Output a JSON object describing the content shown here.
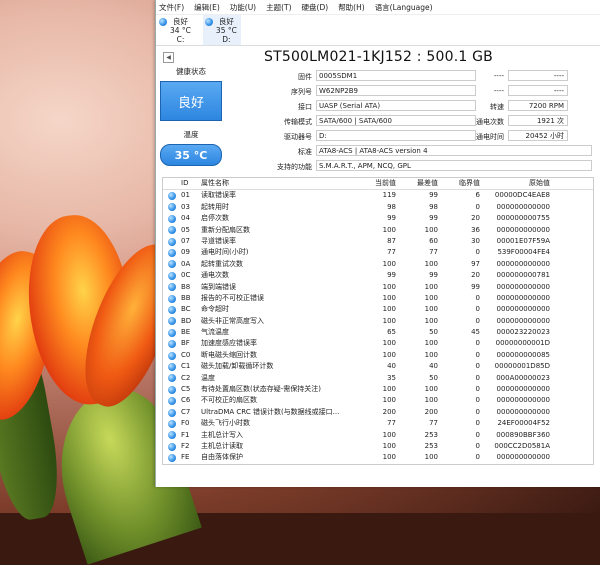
{
  "menu": [
    "文件(F)",
    "编辑(E)",
    "功能(U)",
    "主题(T)",
    "硬盘(D)",
    "帮助(H)",
    "语言(Language)"
  ],
  "disks": [
    {
      "status": "良好",
      "temp": "34 °C",
      "letter": "C:"
    },
    {
      "status": "良好",
      "temp": "35 °C",
      "letter": "D:"
    }
  ],
  "model": "ST500LM021-1KJ152 : 500.1 GB",
  "left": {
    "health_label": "健康状态",
    "health_value": "良好",
    "temp_label": "温度",
    "temp_value": "35 °C"
  },
  "info": {
    "firmware_label": "固件",
    "firmware": "0005SDM1",
    "serial_label": "序列号",
    "serial": "W62NP2B9",
    "interface_label": "接口",
    "interface": "UASP (Serial ATA)",
    "transfer_label": "传输模式",
    "transfer": "SATA/600 | SATA/600",
    "drive_label": "驱动器号",
    "drive": "D:",
    "standard_label": "标准",
    "standard": "ATA8-ACS | ATA8-ACS version 4",
    "features_label": "支持的功能",
    "features": "S.M.A.R.T., APM, NCQ, GPL",
    "r1_label": "----",
    "r1_value": "----",
    "r2_label": "----",
    "r2_value": "----",
    "rpm_label": "转速",
    "rpm": "7200 RPM",
    "power_count_label": "通电次数",
    "power_count": "1921 次",
    "power_hours_label": "通电时间",
    "power_hours": "20452 小时"
  },
  "table": {
    "headers": [
      "ID",
      "属性名称",
      "当前值",
      "最差值",
      "临界值",
      "原始值"
    ],
    "rows": [
      [
        "01",
        "读取错误率",
        "119",
        "99",
        "6",
        "00000DC4EAE8"
      ],
      [
        "03",
        "起转用时",
        "98",
        "98",
        "0",
        "000000000000"
      ],
      [
        "04",
        "启停次数",
        "99",
        "99",
        "20",
        "000000000755"
      ],
      [
        "05",
        "重新分配扇区数",
        "100",
        "100",
        "36",
        "000000000000"
      ],
      [
        "07",
        "寻道错误率",
        "87",
        "60",
        "30",
        "00001E07F59A"
      ],
      [
        "09",
        "通电时间(小时)",
        "77",
        "77",
        "0",
        "539F00004FE4"
      ],
      [
        "0A",
        "起转重试次数",
        "100",
        "100",
        "97",
        "000000000000"
      ],
      [
        "0C",
        "通电次数",
        "99",
        "99",
        "20",
        "000000000781"
      ],
      [
        "B8",
        "端到端错误",
        "100",
        "100",
        "99",
        "000000000000"
      ],
      [
        "BB",
        "报告的不可校正错误",
        "100",
        "100",
        "0",
        "000000000000"
      ],
      [
        "BC",
        "命令超时",
        "100",
        "100",
        "0",
        "000000000000"
      ],
      [
        "BD",
        "磁头非正常高度写入",
        "100",
        "100",
        "0",
        "000000000000"
      ],
      [
        "BE",
        "气流温度",
        "65",
        "50",
        "45",
        "000023220023"
      ],
      [
        "BF",
        "加速度感应错误率",
        "100",
        "100",
        "0",
        "00000000001D"
      ],
      [
        "C0",
        "断电磁头缩回计数",
        "100",
        "100",
        "0",
        "000000000085"
      ],
      [
        "C1",
        "磁头加载/卸载循环计数",
        "40",
        "40",
        "0",
        "00000001D85D"
      ],
      [
        "C2",
        "温度",
        "35",
        "50",
        "0",
        "000A00000023"
      ],
      [
        "C5",
        "有待处置扇区数(状态存疑-需保持关注)",
        "100",
        "100",
        "0",
        "000000000000"
      ],
      [
        "C6",
        "不可校正的扇区数",
        "100",
        "100",
        "0",
        "000000000000"
      ],
      [
        "C7",
        "UltraDMA CRC 错误计数(与数据线或接口...",
        "200",
        "200",
        "0",
        "000000000000"
      ],
      [
        "F0",
        "磁头飞行小时数",
        "77",
        "77",
        "0",
        "24EF00004F52"
      ],
      [
        "F1",
        "主机总计写入",
        "100",
        "253",
        "0",
        "000890BBF360"
      ],
      [
        "F2",
        "主机总计读取",
        "100",
        "253",
        "0",
        "000CC2D0581A"
      ],
      [
        "FE",
        "自由落体保护",
        "100",
        "100",
        "0",
        "000000000000"
      ]
    ]
  }
}
